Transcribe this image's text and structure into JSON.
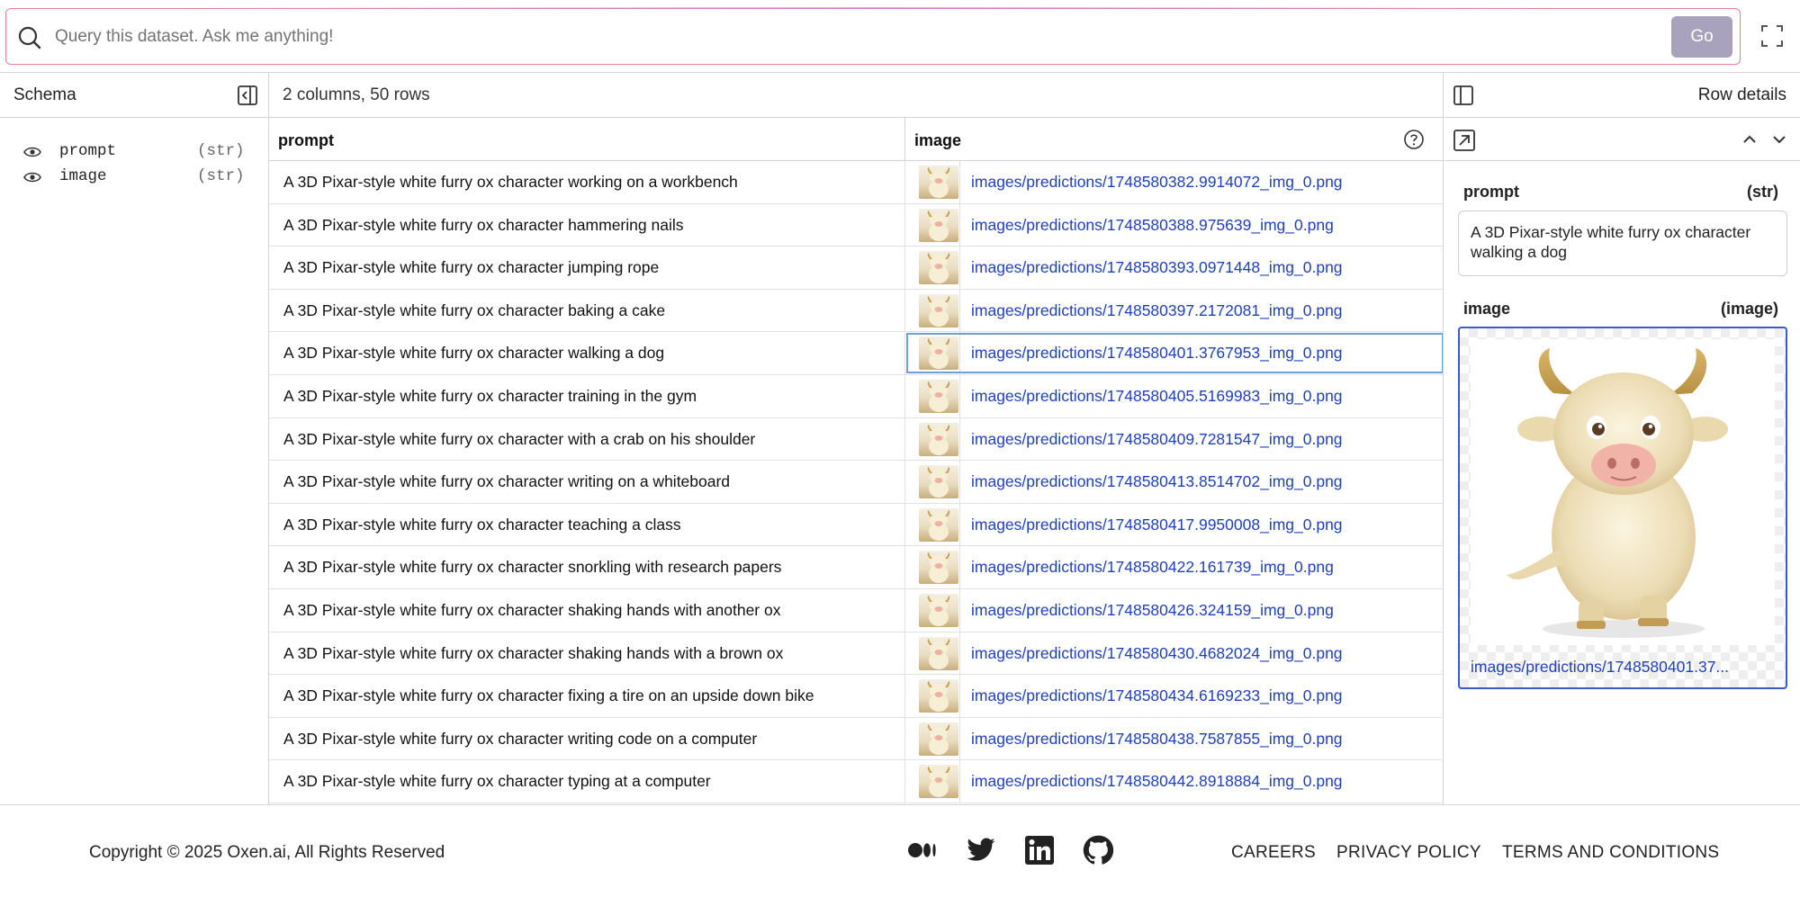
{
  "query": {
    "placeholder": "Query this dataset. Ask me anything!",
    "go_label": "Go"
  },
  "schema": {
    "title": "Schema",
    "fields": [
      {
        "name": "prompt",
        "type": "(str)"
      },
      {
        "name": "image",
        "type": "(str)"
      }
    ]
  },
  "grid": {
    "summary": "2 columns, 50 rows",
    "columns": [
      "prompt",
      "image"
    ],
    "rows": [
      {
        "prompt": "A 3D Pixar-style white furry ox character working on a workbench",
        "image": "images/predictions/1748580382.9914072_img_0.png"
      },
      {
        "prompt": "A 3D Pixar-style white furry ox character hammering nails",
        "image": "images/predictions/1748580388.975639_img_0.png"
      },
      {
        "prompt": "A 3D Pixar-style white furry ox character jumping rope",
        "image": "images/predictions/1748580393.0971448_img_0.png"
      },
      {
        "prompt": "A 3D Pixar-style white furry ox character baking a cake",
        "image": "images/predictions/1748580397.2172081_img_0.png"
      },
      {
        "prompt": "A 3D Pixar-style white furry ox character walking a dog",
        "image": "images/predictions/1748580401.3767953_img_0.png"
      },
      {
        "prompt": "A 3D Pixar-style white furry ox character training in the gym",
        "image": "images/predictions/1748580405.5169983_img_0.png"
      },
      {
        "prompt": "A 3D Pixar-style white furry ox character with a crab on his shoulder",
        "image": "images/predictions/1748580409.7281547_img_0.png"
      },
      {
        "prompt": "A 3D Pixar-style white furry ox character writing on a whiteboard",
        "image": "images/predictions/1748580413.8514702_img_0.png"
      },
      {
        "prompt": "A 3D Pixar-style white furry ox character teaching a class",
        "image": "images/predictions/1748580417.9950008_img_0.png"
      },
      {
        "prompt": "A 3D Pixar-style white furry ox character snorkling with research papers",
        "image": "images/predictions/1748580422.161739_img_0.png"
      },
      {
        "prompt": "A 3D Pixar-style white furry ox character shaking hands with another ox",
        "image": "images/predictions/1748580426.324159_img_0.png"
      },
      {
        "prompt": "A 3D Pixar-style white furry ox character shaking hands with a brown ox",
        "image": "images/predictions/1748580430.4682024_img_0.png"
      },
      {
        "prompt": "A 3D Pixar-style white furry ox character fixing a tire on an upside down bike",
        "image": "images/predictions/1748580434.6169233_img_0.png"
      },
      {
        "prompt": "A 3D Pixar-style white furry ox character writing code on a computer",
        "image": "images/predictions/1748580438.7587855_img_0.png"
      },
      {
        "prompt": "A 3D Pixar-style white furry ox character typing at a computer",
        "image": "images/predictions/1748580442.8918884_img_0.png"
      }
    ],
    "selected_row": 4
  },
  "row_details": {
    "title": "Row details",
    "prompt_label": "prompt",
    "prompt_type": "(str)",
    "prompt_value": "A 3D Pixar-style white furry ox character walking a dog",
    "image_label": "image",
    "image_type": "(image)",
    "image_link": "images/predictions/1748580401.37..."
  },
  "footer": {
    "copyright": "Copyright © 2025 Oxen.ai, All Rights Reserved",
    "links": [
      "CAREERS",
      "PRIVACY POLICY",
      "TERMS AND CONDITIONS"
    ]
  },
  "icons": {
    "social": [
      "medium-icon",
      "twitter-icon",
      "linkedin-icon",
      "github-icon"
    ]
  },
  "colors": {
    "link": "#1f3fbf",
    "go_button": "#a8a2bd",
    "selection": "#6aa0db",
    "query_border": "#f07d8b"
  }
}
